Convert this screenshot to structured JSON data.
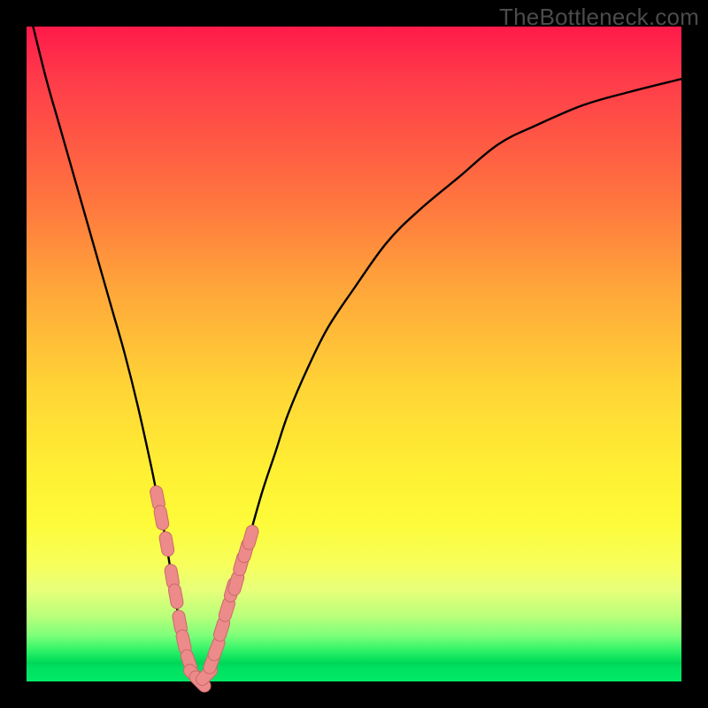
{
  "watermark": "TheBottleneck.com",
  "colors": {
    "frame": "#000000",
    "curve": "#000000",
    "marker_fill": "#ed8a8a",
    "marker_stroke": "#c96a6a"
  },
  "chart_data": {
    "type": "line",
    "title": "",
    "xlabel": "",
    "ylabel": "",
    "xlim": [
      0,
      100
    ],
    "ylim": [
      0,
      100
    ],
    "grid": false,
    "legend": false,
    "series": [
      {
        "name": "bottleneck-curve",
        "x": [
          1,
          3,
          5,
          7,
          9,
          11,
          13,
          15,
          17,
          19,
          20,
          21,
          22,
          23,
          24,
          25,
          26,
          27,
          28,
          30,
          32,
          34,
          36,
          38,
          40,
          43,
          46,
          50,
          55,
          60,
          66,
          72,
          78,
          85,
          92,
          100
        ],
        "values": [
          100,
          92,
          85,
          78,
          71,
          64,
          57,
          50,
          42,
          33,
          28,
          23,
          17,
          11,
          6,
          2,
          0,
          0,
          2,
          8,
          15,
          22,
          29,
          35,
          41,
          48,
          54,
          60,
          67,
          72,
          77,
          82,
          85,
          88,
          90,
          92
        ]
      }
    ],
    "markers": [
      {
        "x": 20.0,
        "y": 28
      },
      {
        "x": 20.6,
        "y": 25
      },
      {
        "x": 21.4,
        "y": 21
      },
      {
        "x": 22.2,
        "y": 16
      },
      {
        "x": 22.8,
        "y": 13
      },
      {
        "x": 23.4,
        "y": 9
      },
      {
        "x": 24.0,
        "y": 6
      },
      {
        "x": 24.8,
        "y": 3
      },
      {
        "x": 25.6,
        "y": 1
      },
      {
        "x": 26.5,
        "y": 0
      },
      {
        "x": 27.5,
        "y": 1
      },
      {
        "x": 28.3,
        "y": 3
      },
      {
        "x": 29.0,
        "y": 5
      },
      {
        "x": 29.8,
        "y": 8
      },
      {
        "x": 30.6,
        "y": 11
      },
      {
        "x": 31.4,
        "y": 14
      },
      {
        "x": 32.0,
        "y": 15
      },
      {
        "x": 32.8,
        "y": 18
      },
      {
        "x": 33.5,
        "y": 20
      },
      {
        "x": 34.2,
        "y": 22
      }
    ]
  }
}
